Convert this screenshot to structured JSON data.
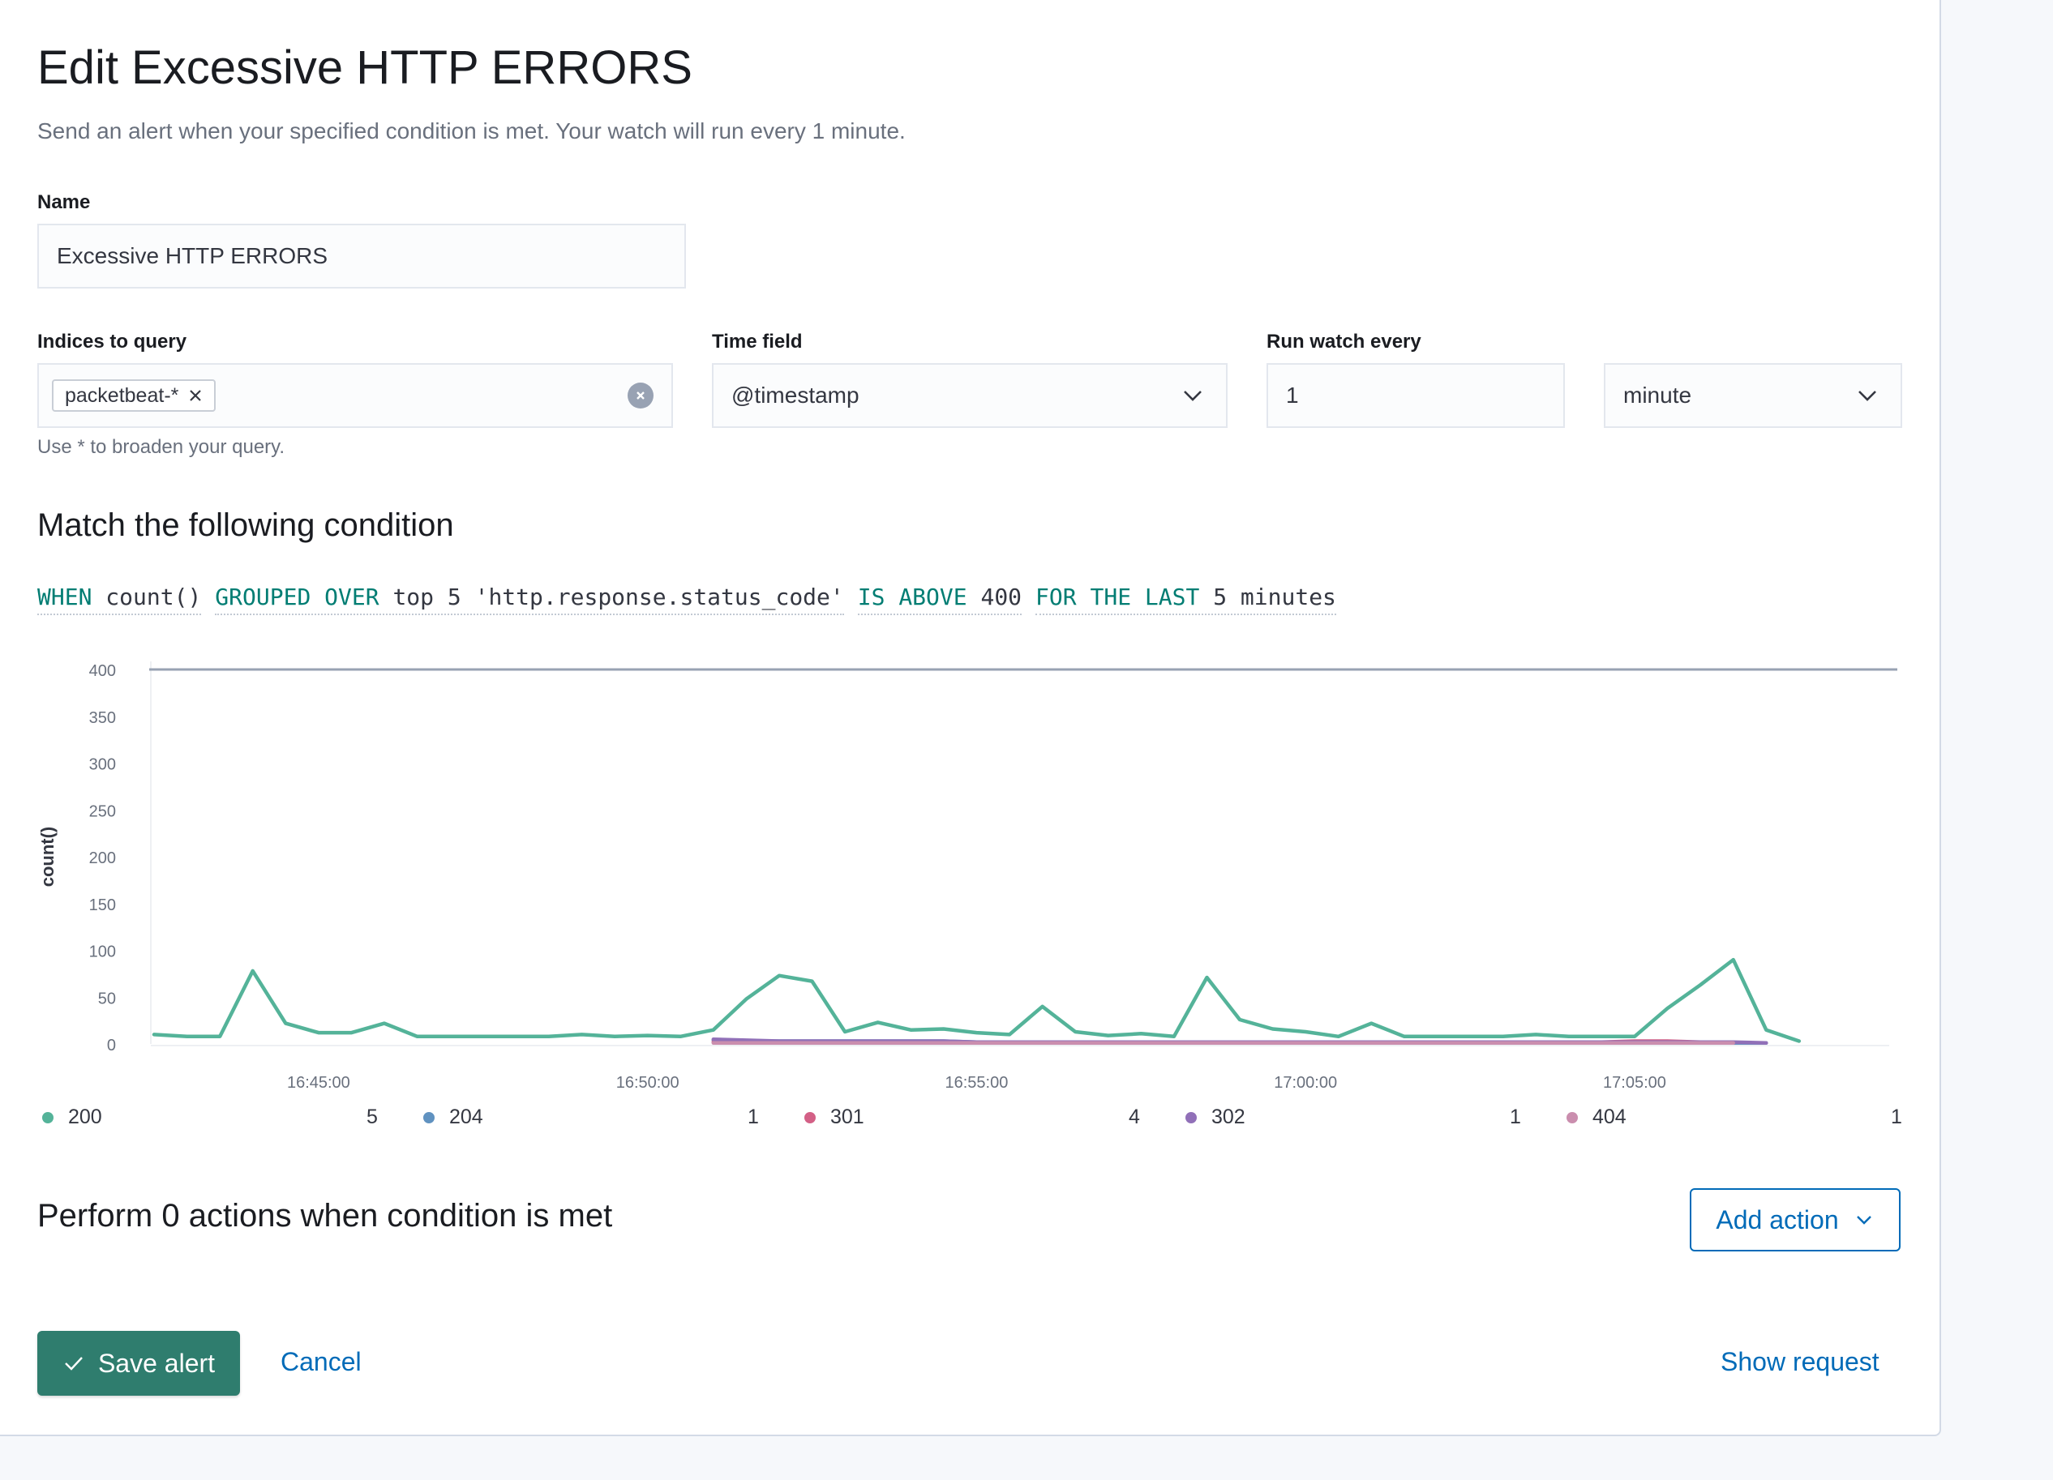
{
  "page": {
    "title": "Edit Excessive HTTP ERRORS",
    "subtitle": "Send an alert when your specified condition is met. Your watch will run every 1 minute."
  },
  "form": {
    "name_label": "Name",
    "name_value": "Excessive HTTP ERRORS",
    "indices_label": "Indices to query",
    "indices": [
      "packetbeat-*"
    ],
    "indices_help": "Use * to broaden your query.",
    "time_field_label": "Time field",
    "time_field_value": "@timestamp",
    "run_every_label": "Run watch every",
    "run_every_value": "1",
    "run_every_unit": "minute"
  },
  "condition": {
    "heading": "Match the following condition",
    "parts": [
      [
        {
          "t": "WHEN",
          "k": true
        },
        {
          "t": " count()",
          "k": false
        }
      ],
      [
        {
          "t": "GROUPED OVER",
          "k": true
        },
        {
          "t": " top 5 'http.response.status_code'",
          "k": false
        }
      ],
      [
        {
          "t": "IS ABOVE",
          "k": true
        },
        {
          "t": " 400",
          "k": false
        }
      ],
      [
        {
          "t": "FOR THE LAST",
          "k": true
        },
        {
          "t": " 5 minutes",
          "k": false
        }
      ]
    ]
  },
  "chart_data": {
    "type": "line",
    "ylabel": "count()",
    "ylim": [
      0,
      400
    ],
    "yticks": [
      0,
      50,
      100,
      150,
      200,
      250,
      300,
      350,
      400
    ],
    "x_start": "16:42:30",
    "x_step_seconds": 30,
    "xticks": [
      "16:45:00",
      "16:50:00",
      "16:55:00",
      "17:00:00",
      "17:05:00"
    ],
    "threshold": 400,
    "series": [
      {
        "name": "200",
        "count": "5",
        "color": "#54b399",
        "values": [
          10,
          8,
          8,
          78,
          22,
          12,
          12,
          22,
          8,
          8,
          8,
          8,
          8,
          10,
          8,
          9,
          8,
          15,
          48,
          73,
          67,
          13,
          23,
          15,
          16,
          12,
          10,
          40,
          13,
          9,
          11,
          8,
          71,
          26,
          16,
          13,
          8,
          22,
          8,
          8,
          8,
          8,
          10,
          8,
          8,
          8,
          38,
          63,
          90,
          15,
          3
        ]
      },
      {
        "name": "204",
        "count": "1",
        "color": "#6092c0",
        "start": "16:51:00",
        "values": [
          4,
          3,
          3,
          3,
          3,
          3,
          3,
          3,
          2,
          2,
          2,
          2,
          2,
          2,
          2,
          2,
          2,
          2,
          2,
          2,
          2,
          2,
          2,
          2,
          2,
          2,
          2,
          2,
          2,
          2,
          2,
          1,
          1
        ]
      },
      {
        "name": "301",
        "count": "4",
        "color": "#d36086",
        "start": "16:51:00",
        "values": [
          2,
          2,
          2,
          2,
          2,
          2,
          2,
          2,
          2,
          2,
          2,
          2,
          2,
          2,
          2,
          2,
          2,
          2,
          2,
          2,
          2,
          2,
          2,
          2,
          2,
          2,
          2,
          2,
          3,
          3,
          2,
          1
        ]
      },
      {
        "name": "302",
        "count": "1",
        "color": "#9170b8",
        "start": "16:51:00",
        "values": [
          5,
          4,
          3,
          3,
          3,
          3,
          3,
          3,
          2,
          2,
          2,
          2,
          2,
          2,
          2,
          2,
          2,
          2,
          2,
          2,
          2,
          2,
          2,
          2,
          2,
          2,
          2,
          2,
          2,
          2,
          2,
          2,
          1
        ]
      },
      {
        "name": "404",
        "count": "1",
        "color": "#ca8eae",
        "start": "16:51:00",
        "values": [
          1,
          1,
          1,
          1,
          1,
          1,
          1,
          1,
          1,
          1,
          1,
          1,
          1,
          1,
          1,
          1,
          1,
          1,
          1,
          1,
          1,
          1,
          1,
          1,
          1,
          1,
          1,
          1,
          1,
          1,
          1,
          1
        ]
      }
    ]
  },
  "actions": {
    "heading": "Perform 0 actions when condition is met",
    "add_action_label": "Add action"
  },
  "footer": {
    "save_label": "Save alert",
    "cancel_label": "Cancel",
    "show_request_label": "Show request"
  }
}
